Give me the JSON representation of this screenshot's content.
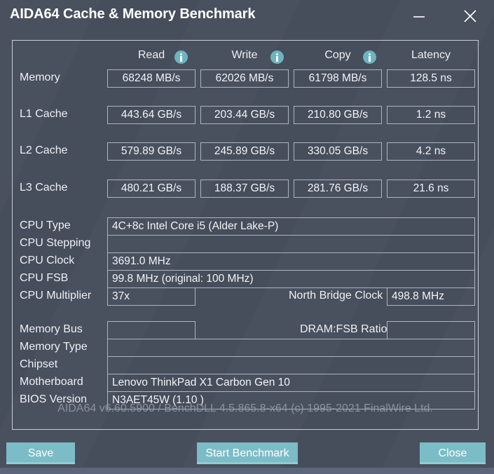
{
  "window": {
    "title": "AIDA64 Cache & Memory Benchmark",
    "minimize_icon": "minimize-icon",
    "close_icon": "close-icon"
  },
  "colors": {
    "background": "#474e5c",
    "accent_teal": "#7cbcc6",
    "info_icon": "#6cb4c0",
    "border": "#aeb5c1",
    "panel_border": "#c9ced8",
    "text": "#eef0f4",
    "muted_text": "#8b93a1",
    "bottom_strip": "#5b6678"
  },
  "benchmark": {
    "columns": [
      {
        "label": "Read",
        "info_icon": "info-icon",
        "has_info": true
      },
      {
        "label": "Write",
        "info_icon": "info-icon",
        "has_info": true
      },
      {
        "label": "Copy",
        "info_icon": "info-icon",
        "has_info": true
      },
      {
        "label": "Latency",
        "has_info": false
      }
    ],
    "rows": [
      {
        "label": "Memory",
        "read": "68248 MB/s",
        "write": "62026 MB/s",
        "copy": "61798 MB/s",
        "latency": "128.5 ns"
      },
      {
        "label": "L1 Cache",
        "read": "443.64 GB/s",
        "write": "203.44 GB/s",
        "copy": "210.80 GB/s",
        "latency": "1.2 ns"
      },
      {
        "label": "L2 Cache",
        "read": "579.89 GB/s",
        "write": "245.89 GB/s",
        "copy": "330.05 GB/s",
        "latency": "4.2 ns"
      },
      {
        "label": "L3 Cache",
        "read": "480.21 GB/s",
        "write": "188.37 GB/s",
        "copy": "281.76 GB/s",
        "latency": "21.6 ns"
      }
    ]
  },
  "cpu_info": {
    "type_label": "CPU Type",
    "type_value": "4C+8c Intel Core i5  (Alder Lake-P)",
    "stepping_label": "CPU Stepping",
    "stepping_value": "",
    "clock_label": "CPU Clock",
    "clock_value": "3691.0 MHz",
    "fsb_label": "CPU FSB",
    "fsb_value": "99.8 MHz  (original: 100 MHz)",
    "multiplier_label": "CPU Multiplier",
    "multiplier_value": "37x",
    "north_bridge_label": "North Bridge Clock",
    "north_bridge_value": "498.8 MHz"
  },
  "memory_info": {
    "bus_label": "Memory Bus",
    "bus_value": "",
    "dram_fsb_label": "DRAM:FSB Ratio",
    "dram_fsb_value": "",
    "type_label": "Memory Type",
    "type_value": "",
    "chipset_label": "Chipset",
    "chipset_value": "",
    "motherboard_label": "Motherboard",
    "motherboard_value": "Lenovo ThinkPad X1 Carbon Gen 10",
    "bios_label": "BIOS Version",
    "bios_value": "N3AET45W (1.10 )"
  },
  "footer": {
    "version_text": "AIDA64 v6.60.5900 / BenchDLL 4.5.865.8-x64  (c) 1995-2021 FinalWire Ltd.",
    "save_label": "Save",
    "start_benchmark_label": "Start Benchmark",
    "close_label": "Close"
  }
}
